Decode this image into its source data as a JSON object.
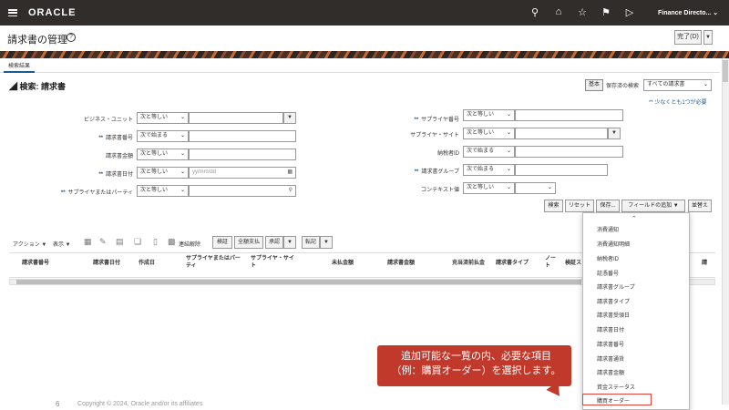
{
  "header": {
    "logo": "ORACLE",
    "user_menu": "Finance Directo...",
    "icons": [
      "search-icon",
      "home-icon",
      "star-icon",
      "flag-icon",
      "notifications-icon"
    ]
  },
  "page": {
    "title": "請求書の管理",
    "done_button": "完了(D)",
    "tab": "検索結果"
  },
  "search": {
    "title": "検索: 請求書",
    "basic_button": "基本",
    "saved_search_label": "保存済の検索",
    "saved_search_value": "すべての請求書",
    "required_note": "** 少なくとも1つが必要",
    "fields_left": [
      {
        "label": "ビジネス・ユニット",
        "required": false,
        "operator": "次と等しい",
        "value": ""
      },
      {
        "label": "請求書番号",
        "required": true,
        "operator": "次で始まる",
        "value": ""
      },
      {
        "label": "請求書金額",
        "required": false,
        "operator": "次と等しい",
        "value": ""
      },
      {
        "label": "請求書日付",
        "required": true,
        "operator": "次と等しい",
        "value": "yy/mm/dd"
      },
      {
        "label": "サプライヤまたはパーティ",
        "required": true,
        "operator": "次と等しい",
        "value": ""
      }
    ],
    "fields_right": [
      {
        "label": "サプライヤ番号",
        "required": true,
        "operator": "次と等しい",
        "value": ""
      },
      {
        "label": "サプライヤ・サイト",
        "required": false,
        "operator": "次と等しい",
        "value": ""
      },
      {
        "label": "納税者ID",
        "required": false,
        "operator": "次で始まる",
        "value": ""
      },
      {
        "label": "請求書グループ",
        "required": true,
        "operator": "次で始まる",
        "value": ""
      },
      {
        "label": "コンテキスト値",
        "required": false,
        "operator": "次と等しい",
        "value": ""
      }
    ],
    "buttons": {
      "search": "検索",
      "reset": "リセット",
      "save": "保存...",
      "add_fields": "フィールドの追加",
      "reorder": "並替え"
    }
  },
  "results_toolbar": {
    "actions": "アクション",
    "view": "表示",
    "unlink": "連結解除",
    "validate": "検証",
    "pay_in_full": "全額支払",
    "approve": "承認",
    "post": "転記"
  },
  "table": {
    "columns": [
      "請求書番号",
      "請求書日付",
      "作成日",
      "サプライヤまたはパーティ",
      "サプライヤ・サイト",
      "未払金額",
      "請求書金額",
      "充当済前払金",
      "請求書タイプ",
      "ノート",
      "検証ス",
      "請"
    ]
  },
  "dropdown": {
    "items": [
      "消費通知",
      "消費通知明細",
      "納税者ID",
      "証憑番号",
      "請求書グループ",
      "請求書タイプ",
      "請求書受領日",
      "請求書日付",
      "請求書番号",
      "請求書通貨",
      "請求書金額",
      "資金ステータス",
      "購買オーダー"
    ],
    "highlighted": "購買オーダー"
  },
  "callout": {
    "line1": "追加可能な一覧の内、必要な項目",
    "line2": "（例：購買オーダー）を選択します。"
  },
  "footer": {
    "page_number": "6",
    "copyright": "Copyright © 2024, Oracle and/or its affiliates"
  },
  "colors": {
    "topbar": "#312d2a",
    "accent": "#1a5a96",
    "callout": "#c0392b"
  }
}
